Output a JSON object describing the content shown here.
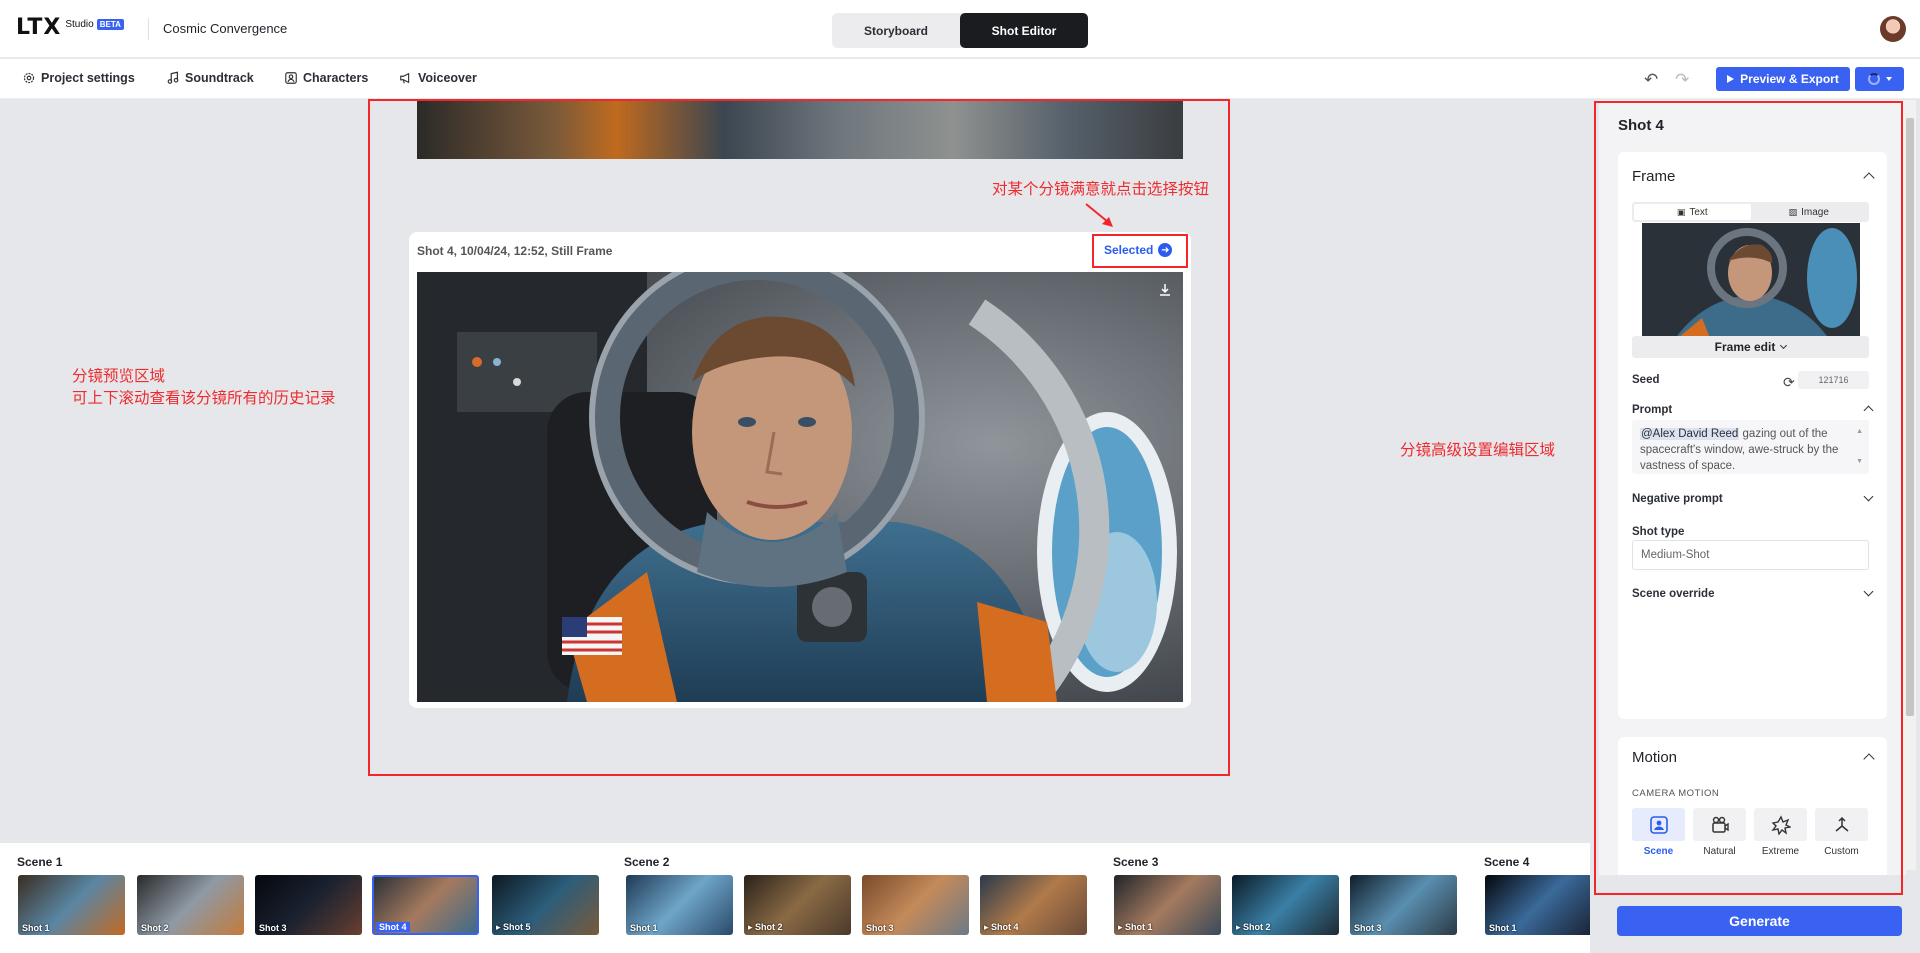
{
  "app": {
    "logo_text": "LTX",
    "logo_sub": "Studio",
    "beta_badge": "BETA",
    "project_name": "Cosmic Convergence"
  },
  "mode_switch": {
    "storyboard": "Storyboard",
    "shot_editor": "Shot Editor",
    "active": "Shot Editor"
  },
  "nav": {
    "project_settings": "Project settings",
    "soundtrack": "Soundtrack",
    "characters": "Characters",
    "voiceover": "Voiceover"
  },
  "toolbar": {
    "export_label": "Preview & Export"
  },
  "shot_card": {
    "meta": "Shot 4, 10/04/24, 12:52, Still Frame",
    "selected_label": "Selected"
  },
  "annotations": {
    "preview_area_line1": "分镜预览区域",
    "preview_area_line2": "可上下滚动查看该分镜所有的历史记录",
    "select_hint": "对某个分镜满意就点击选择按钮",
    "settings_area": "分镜高级设置编辑区域",
    "color": "#f2262b"
  },
  "panel": {
    "title": "Shot 4",
    "frame": {
      "heading": "Frame",
      "tab_text": "Text",
      "tab_image": "Image",
      "frame_edit": "Frame edit",
      "seed_label": "Seed",
      "seed_value": "121716",
      "prompt_label": "Prompt",
      "prompt_mention": "@Alex David Reed",
      "prompt_text": " gazing out of the spacecraft's window, awe-struck by the vastness of space.",
      "negative_prompt_label": "Negative prompt",
      "shot_type_label": "Shot type",
      "shot_type_value": "Medium-Shot",
      "scene_override_label": "Scene override"
    },
    "motion": {
      "heading": "Motion",
      "camera_motion_label": "CAMERA MOTION",
      "options": [
        "Scene",
        "Natural",
        "Extreme",
        "Custom"
      ],
      "active": "Scene"
    },
    "generate_label": "Generate"
  },
  "scenes": [
    {
      "title": "Scene 1",
      "shots": [
        "Shot 1",
        "Shot 2",
        "Shot 3",
        "Shot 4",
        "Shot 5"
      ],
      "selected": "Shot 4"
    },
    {
      "title": "Scene 2",
      "shots": [
        "Shot 1",
        "Shot 2",
        "Shot 3",
        "Shot 4"
      ]
    },
    {
      "title": "Scene 3",
      "shots": [
        "Shot 1",
        "Shot 2",
        "Shot 3"
      ]
    },
    {
      "title": "Scene 4",
      "shots": [
        "Shot 1"
      ]
    }
  ],
  "colors": {
    "accent": "#3a62f2",
    "dark": "#1b1c1f",
    "canvas": "#e6e7ea"
  }
}
